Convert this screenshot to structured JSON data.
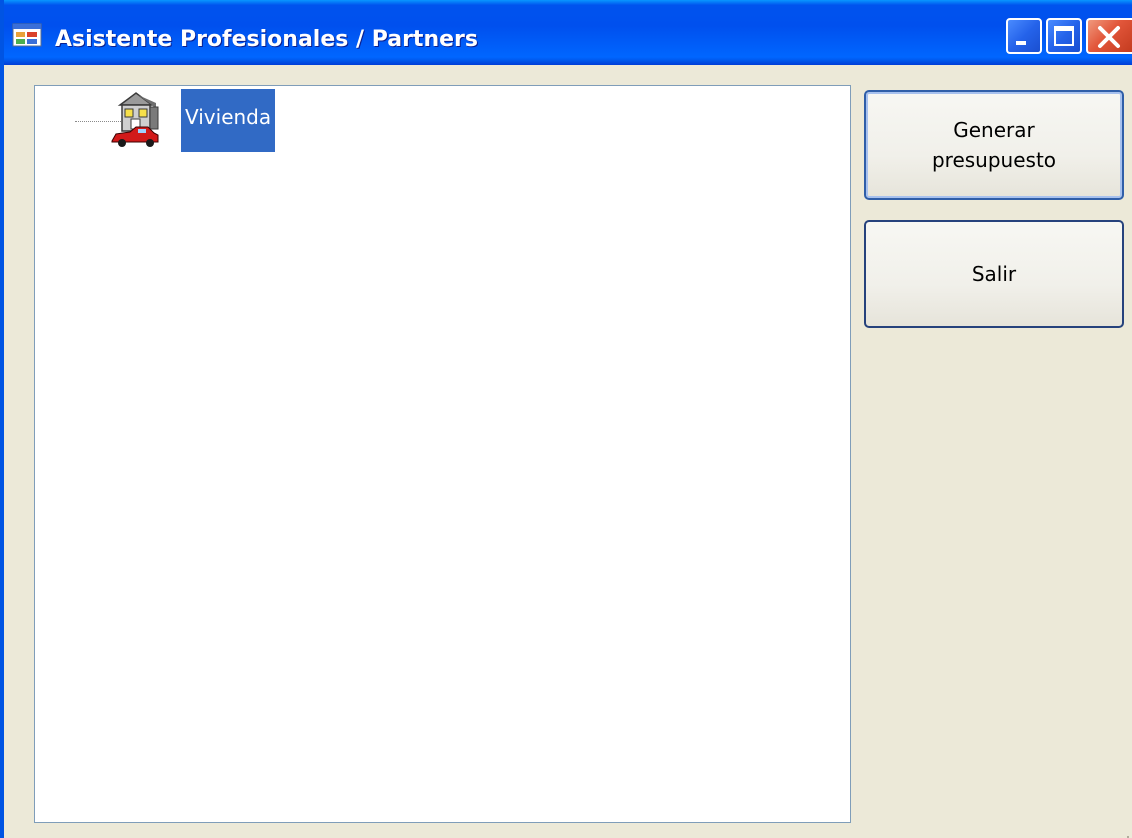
{
  "window": {
    "title": "Asistente Profesionales / Partners",
    "title_icon": "app-window-icon",
    "controls": [
      "minimize-icon",
      "maximize-icon",
      "close-icon"
    ]
  },
  "tree": {
    "nodes": [
      {
        "label": "Vivienda",
        "icon": "house-car-icon",
        "selected": true
      }
    ]
  },
  "buttons": {
    "generar": "Generar\npresupuesto",
    "salir": "Salir"
  },
  "colors": {
    "titlebar": "#0054e3",
    "selection": "#316ac5",
    "dialog_background": "#ece9d8",
    "close_button": "#e2563a"
  }
}
